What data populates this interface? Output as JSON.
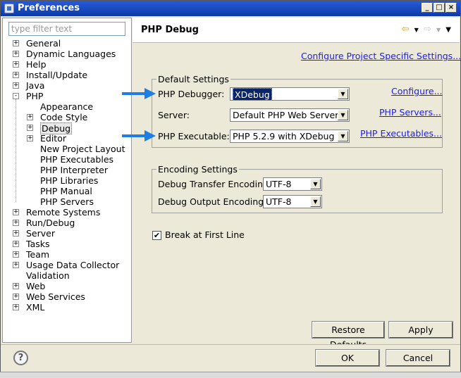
{
  "window": {
    "title": "Preferences"
  },
  "filter": {
    "placeholder": "type filter text"
  },
  "tree": {
    "items": [
      {
        "label": "General",
        "level": 0,
        "expander": "+"
      },
      {
        "label": "Dynamic Languages",
        "level": 0,
        "expander": "+"
      },
      {
        "label": "Help",
        "level": 0,
        "expander": "+"
      },
      {
        "label": "Install/Update",
        "level": 0,
        "expander": "+"
      },
      {
        "label": "Java",
        "level": 0,
        "expander": "+"
      },
      {
        "label": "PHP",
        "level": 0,
        "expander": "-"
      },
      {
        "label": "Appearance",
        "level": 1,
        "expander": ""
      },
      {
        "label": "Code Style",
        "level": 1,
        "expander": "+"
      },
      {
        "label": "Debug",
        "level": 1,
        "expander": "+",
        "selected": true
      },
      {
        "label": "Editor",
        "level": 1,
        "expander": "+"
      },
      {
        "label": "New Project Layout",
        "level": 1,
        "expander": ""
      },
      {
        "label": "PHP Executables",
        "level": 1,
        "expander": ""
      },
      {
        "label": "PHP Interpreter",
        "level": 1,
        "expander": ""
      },
      {
        "label": "PHP Libraries",
        "level": 1,
        "expander": ""
      },
      {
        "label": "PHP Manual",
        "level": 1,
        "expander": ""
      },
      {
        "label": "PHP Servers",
        "level": 1,
        "expander": ""
      },
      {
        "label": "Remote Systems",
        "level": 0,
        "expander": "+"
      },
      {
        "label": "Run/Debug",
        "level": 0,
        "expander": "+"
      },
      {
        "label": "Server",
        "level": 0,
        "expander": "+"
      },
      {
        "label": "Tasks",
        "level": 0,
        "expander": "+"
      },
      {
        "label": "Team",
        "level": 0,
        "expander": "+"
      },
      {
        "label": "Usage Data Collector",
        "level": 0,
        "expander": "+"
      },
      {
        "label": "Validation",
        "level": 0,
        "expander": ""
      },
      {
        "label": "Web",
        "level": 0,
        "expander": "+"
      },
      {
        "label": "Web Services",
        "level": 0,
        "expander": "+"
      },
      {
        "label": "XML",
        "level": 0,
        "expander": "+"
      }
    ]
  },
  "page": {
    "title": "PHP Debug",
    "configure_project_link": "Configure Project Specific Settings...",
    "default_settings": {
      "title": "Default Settings",
      "debugger_label": "PHP Debugger:",
      "debugger_value": "XDebug",
      "debugger_link": "Configure...",
      "server_label": "Server:",
      "server_value": "Default PHP Web Server",
      "server_link": "PHP Servers...",
      "executable_label": "PHP Executable:",
      "executable_value": "PHP 5.2.9 with XDebug",
      "executable_link": "PHP Executables..."
    },
    "encoding_settings": {
      "title": "Encoding Settings",
      "transfer_label": "Debug Transfer Encoding",
      "transfer_value": "UTF-8",
      "output_label": "Debug Output Encoding",
      "output_value": "UTF-8"
    },
    "break_first_line": {
      "label": "Break at First Line",
      "checked": "✔"
    },
    "restore_defaults": "Restore Defaults",
    "apply": "Apply"
  },
  "dialog": {
    "ok": "OK",
    "cancel": "Cancel",
    "help": "?"
  },
  "colors": {
    "arrow": "#1e7ee6",
    "link": "#1a1aff",
    "title_bar": "#0b3aa8"
  }
}
